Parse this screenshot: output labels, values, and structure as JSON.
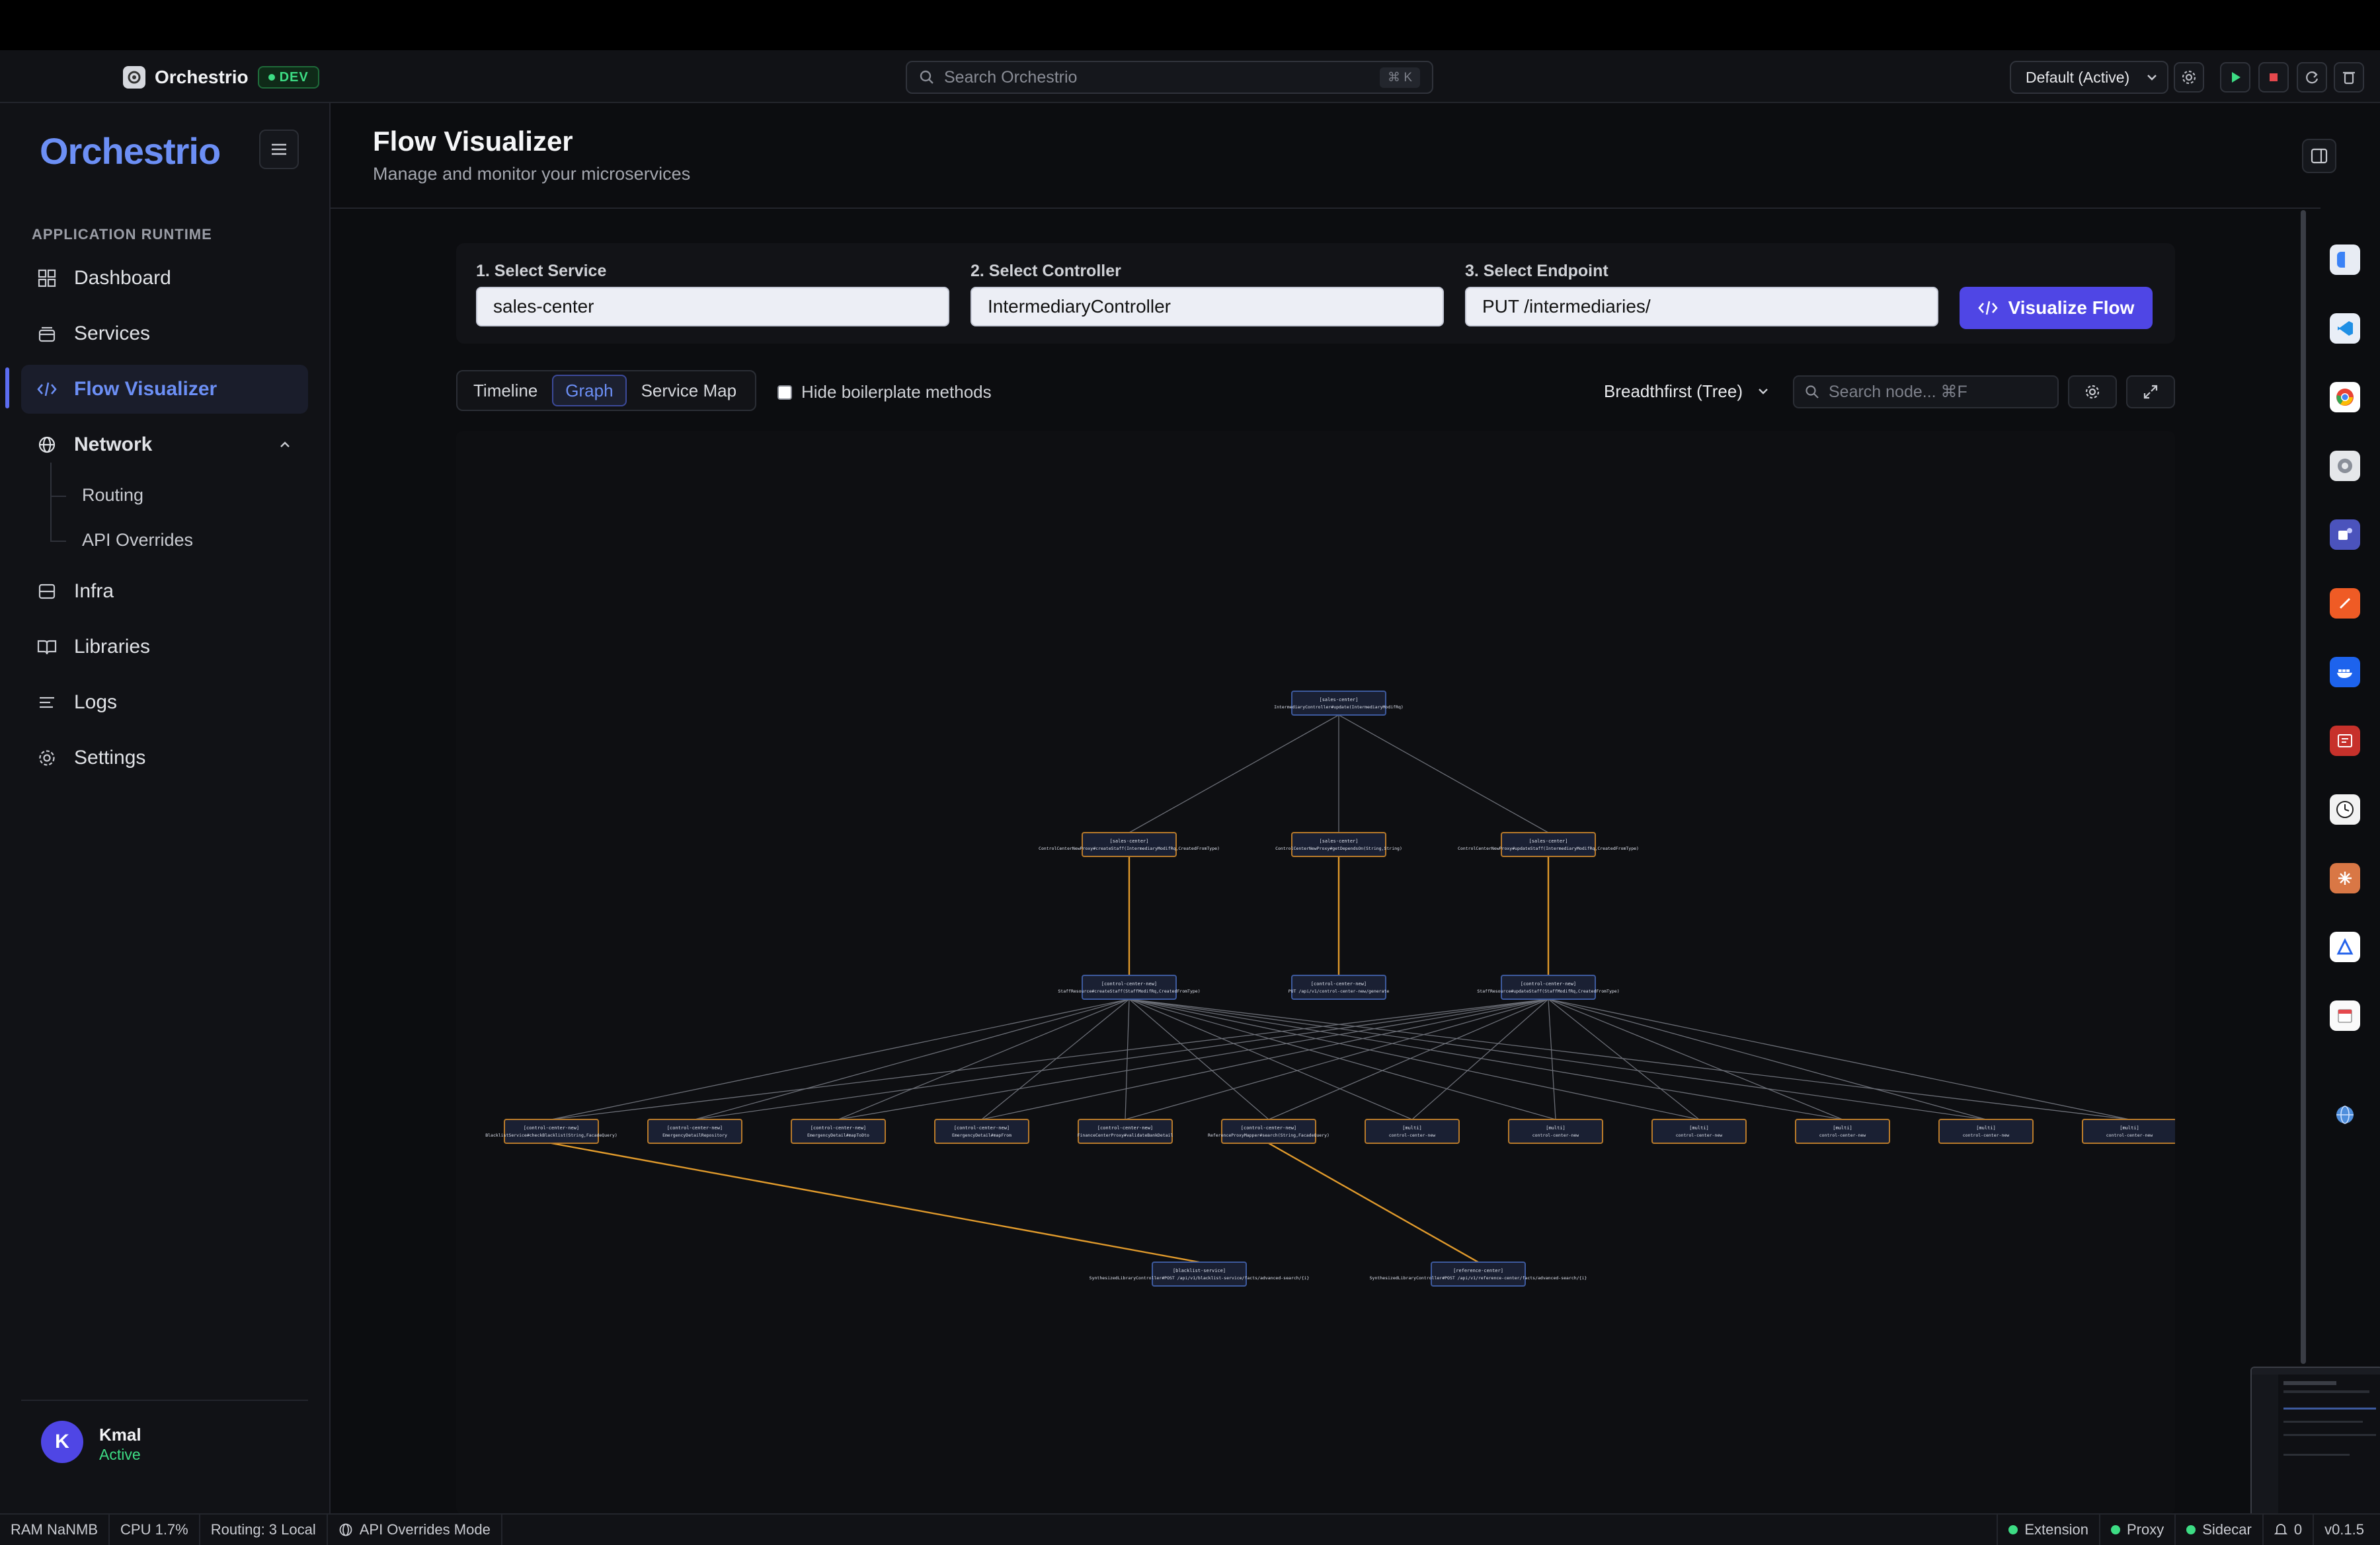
{
  "app": {
    "name": "Orchestrio",
    "env_badge": "DEV",
    "search_placeholder": "Search Orchestrio",
    "search_shortcut": "⌘ K",
    "profile_select": "Default (Active)"
  },
  "sidebar": {
    "logo_text": "Orchestrio",
    "section": "APPLICATION RUNTIME",
    "items": [
      {
        "label": "Dashboard",
        "icon": "grid-icon"
      },
      {
        "label": "Services",
        "icon": "layers-icon"
      },
      {
        "label": "Flow Visualizer",
        "icon": "code-icon",
        "active": true
      },
      {
        "label": "Network",
        "icon": "globe-icon",
        "expanded": true
      },
      {
        "label": "Infra",
        "icon": "server-icon"
      },
      {
        "label": "Libraries",
        "icon": "book-icon"
      },
      {
        "label": "Logs",
        "icon": "list-icon"
      },
      {
        "label": "Settings",
        "icon": "gear-icon"
      }
    ],
    "network_sub": [
      "Routing",
      "API Overrides"
    ],
    "user": {
      "initial": "K",
      "name": "Kmal",
      "status": "Active"
    }
  },
  "page": {
    "title": "Flow Visualizer",
    "subtitle": "Manage and monitor your microservices"
  },
  "selection": {
    "service_label": "1. Select Service",
    "service_value": "sales-center",
    "controller_label": "2. Select Controller",
    "controller_value": "IntermediaryController",
    "endpoint_label": "3. Select Endpoint",
    "endpoint_value": "PUT /intermediaries/",
    "visualize_label": "Visualize Flow"
  },
  "toolbar": {
    "views": [
      "Timeline",
      "Graph",
      "Service Map"
    ],
    "active_view": "Graph",
    "hide_boilerplate": "Hide boilerplate methods",
    "layout": "Breadthfirst (Tree)",
    "node_search_placeholder": "Search node... ⌘F"
  },
  "graph": {
    "colors": {
      "node_border_svc": "#3d5a9e",
      "node_border_ctrl": "#b87a2a",
      "edge": "#6b6e76",
      "edge_hl": "#e09a2c"
    },
    "nodes": [
      {
        "id": "root",
        "label": "[sales-center]",
        "sub": "IntermediaryController#update(IntermediaryModifRq)"
      },
      {
        "id": "a1",
        "label": "[sales-center]",
        "sub": "ControlCenterNewProxy#createStaff(IntermediaryModifRq,CreatedFromType)"
      },
      {
        "id": "a2",
        "label": "[sales-center]",
        "sub": "ControlCenterNewProxy#getDependsOn(String,String)"
      },
      {
        "id": "a3",
        "label": "[sales-center]",
        "sub": "ControlCenterNewProxy#updateStaff(IntermediaryModifRq,CreatedFromType)"
      },
      {
        "id": "b1",
        "label": "[control-center-new]",
        "sub": "StaffResource#createStaff(StaffModifRq,CreatedFromType)"
      },
      {
        "id": "b2",
        "label": "[control-center-new]",
        "sub": "PUT /api/v1/control-center-new/generate"
      },
      {
        "id": "b3",
        "label": "[control-center-new]",
        "sub": "StaffResource#updateStaff(StaffModifRq,CreatedFromType)"
      },
      {
        "id": "c1",
        "label": "[control-center-new]",
        "sub": "BlacklistService#checkBlacklist(String,FacadeQuery)"
      },
      {
        "id": "c2",
        "label": "[control-center-new]",
        "sub": "EmergencyDetailRepository"
      },
      {
        "id": "c3",
        "label": "[control-center-new]",
        "sub": "EmergencyDetail#mapToDto"
      },
      {
        "id": "c4",
        "label": "[control-center-new]",
        "sub": "EmergencyDetail#mapFrom"
      },
      {
        "id": "c5",
        "label": "[control-center-new]",
        "sub": "FinanceCenterProxy#validateBankDetail"
      },
      {
        "id": "c6",
        "label": "[control-center-new]",
        "sub": "ReferenceProxyMapper#search(String,FacadeQuery)"
      },
      {
        "id": "c7",
        "label": "[multi]",
        "sub": "control-center-new"
      },
      {
        "id": "c8",
        "label": "[multi]",
        "sub": "control-center-new"
      },
      {
        "id": "c9",
        "label": "[multi]",
        "sub": "control-center-new"
      },
      {
        "id": "c10",
        "label": "[multi]",
        "sub": "control-center-new"
      },
      {
        "id": "c11",
        "label": "[multi]",
        "sub": "control-center-new"
      },
      {
        "id": "c12",
        "label": "[multi]",
        "sub": "control-center-new"
      },
      {
        "id": "d1",
        "label": "[blacklist-service]",
        "sub": "SynthesizedLibraryController#POST /api/v1/blacklist-service/facts/advanced-search/{i}"
      },
      {
        "id": "d2",
        "label": "[reference-center]",
        "sub": "SynthesizedLibraryController#POST /api/v1/reference-center/facts/advanced-search/{i}"
      }
    ]
  },
  "dock_icons": [
    "finder-icon",
    "vscode-icon",
    "chrome-icon",
    "settings-app-icon",
    "teams-icon",
    "postman-icon",
    "docker-icon",
    "dictionary-icon",
    "clock-icon",
    "claude-icon",
    "ai-app-icon",
    "calendar-icon",
    "globe-icon"
  ],
  "statusbar": {
    "ram": "RAM NaNMB",
    "cpu": "CPU 1.7%",
    "routing": "Routing: 3 Local",
    "overrides": "API Overrides Mode",
    "extension": "Extension",
    "proxy": "Proxy",
    "sidecar": "Sidecar",
    "notifications": "0",
    "version": "v0.1.5"
  }
}
